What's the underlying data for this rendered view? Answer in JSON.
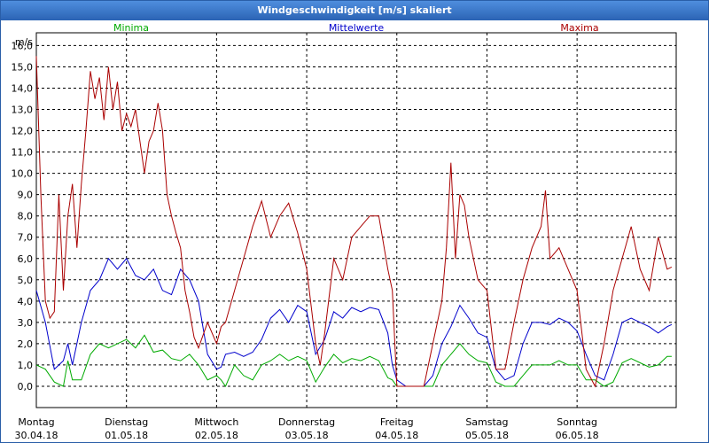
{
  "window": {
    "title": "Windgeschwindigkeit [m/s] skaliert"
  },
  "chart_data": {
    "type": "line",
    "title": "Windgeschwindigkeit [m/s] skaliert",
    "ylabel": "m/s",
    "ylim": [
      -1,
      16.6
    ],
    "y_ticks": [
      "0,0",
      "1,0",
      "2,0",
      "3,0",
      "4,0",
      "5,0",
      "6,0",
      "7,0",
      "8,0",
      "9,0",
      "10,0",
      "11,0",
      "12,0",
      "13,0",
      "14,0",
      "15,0",
      "16,0"
    ],
    "x_range": [
      0,
      7.1
    ],
    "days": [
      {
        "day": "Montag",
        "date": "30.04.18"
      },
      {
        "day": "Dienstag",
        "date": "01.05.18"
      },
      {
        "day": "Mittwoch",
        "date": "02.05.18"
      },
      {
        "day": "Donnerstag",
        "date": "03.05.18"
      },
      {
        "day": "Freitag",
        "date": "04.05.18"
      },
      {
        "day": "Samstag",
        "date": "05.05.18"
      },
      {
        "day": "Sonntag",
        "date": "06.05.18"
      }
    ],
    "grid": true,
    "series": [
      {
        "name": "Minima",
        "color": "#00aa00",
        "x": [
          0.0,
          0.1,
          0.2,
          0.3,
          0.35,
          0.4,
          0.5,
          0.6,
          0.7,
          0.8,
          0.9,
          1.0,
          1.1,
          1.2,
          1.3,
          1.4,
          1.5,
          1.6,
          1.7,
          1.8,
          1.9,
          2.0,
          2.05,
          2.1,
          2.2,
          2.3,
          2.4,
          2.5,
          2.6,
          2.7,
          2.8,
          2.9,
          3.0,
          3.1,
          3.2,
          3.3,
          3.4,
          3.5,
          3.6,
          3.7,
          3.8,
          3.9,
          3.95,
          4.0,
          4.1,
          4.2,
          4.3,
          4.4,
          4.5,
          4.6,
          4.7,
          4.8,
          4.9,
          5.0,
          5.1,
          5.2,
          5.3,
          5.4,
          5.5,
          5.6,
          5.7,
          5.8,
          5.9,
          6.0,
          6.1,
          6.2,
          6.3,
          6.4,
          6.5,
          6.6,
          6.7,
          6.8,
          6.9,
          7.0,
          7.05
        ],
        "y": [
          1.0,
          0.8,
          0.2,
          0.0,
          1.2,
          0.3,
          0.3,
          1.5,
          2.0,
          1.8,
          2.0,
          2.2,
          1.8,
          2.4,
          1.6,
          1.7,
          1.3,
          1.2,
          1.5,
          1.0,
          0.3,
          0.5,
          0.3,
          0.0,
          1.0,
          0.5,
          0.3,
          1.0,
          1.2,
          1.5,
          1.2,
          1.4,
          1.2,
          0.2,
          0.9,
          1.5,
          1.1,
          1.3,
          1.2,
          1.4,
          1.2,
          0.4,
          0.3,
          0.0,
          0.0,
          0.0,
          0.0,
          0.0,
          1.0,
          1.5,
          2.0,
          1.5,
          1.2,
          1.1,
          0.2,
          0.0,
          0.0,
          0.5,
          1.0,
          1.0,
          1.0,
          1.2,
          1.0,
          1.0,
          0.3,
          0.3,
          0.0,
          0.2,
          1.1,
          1.3,
          1.1,
          0.9,
          1.0,
          1.4,
          1.4
        ]
      },
      {
        "name": "Mittelwerte",
        "color": "#0000cc",
        "x": [
          0.0,
          0.1,
          0.2,
          0.3,
          0.35,
          0.4,
          0.5,
          0.6,
          0.7,
          0.8,
          0.9,
          1.0,
          1.1,
          1.2,
          1.3,
          1.4,
          1.5,
          1.6,
          1.7,
          1.8,
          1.9,
          2.0,
          2.05,
          2.1,
          2.2,
          2.3,
          2.4,
          2.5,
          2.6,
          2.7,
          2.8,
          2.9,
          3.0,
          3.1,
          3.2,
          3.3,
          3.4,
          3.5,
          3.6,
          3.7,
          3.8,
          3.9,
          3.95,
          4.0,
          4.1,
          4.2,
          4.3,
          4.4,
          4.5,
          4.6,
          4.7,
          4.8,
          4.9,
          5.0,
          5.1,
          5.2,
          5.3,
          5.4,
          5.5,
          5.6,
          5.7,
          5.8,
          5.9,
          6.0,
          6.1,
          6.2,
          6.3,
          6.4,
          6.5,
          6.6,
          6.7,
          6.8,
          6.9,
          7.0,
          7.05
        ],
        "y": [
          4.5,
          3.0,
          0.8,
          1.2,
          2.0,
          1.0,
          3.0,
          4.5,
          5.0,
          6.0,
          5.5,
          6.0,
          5.2,
          5.0,
          5.5,
          4.5,
          4.3,
          5.5,
          5.0,
          4.0,
          1.5,
          0.8,
          0.9,
          1.5,
          1.6,
          1.4,
          1.6,
          2.2,
          3.2,
          3.6,
          3.0,
          3.8,
          3.5,
          1.5,
          2.2,
          3.5,
          3.2,
          3.7,
          3.5,
          3.7,
          3.6,
          2.5,
          1.0,
          0.3,
          0.0,
          0.0,
          0.0,
          0.5,
          2.0,
          2.8,
          3.8,
          3.2,
          2.5,
          2.3,
          0.8,
          0.3,
          0.5,
          2.0,
          3.0,
          3.0,
          2.9,
          3.2,
          3.0,
          2.6,
          1.5,
          0.5,
          0.3,
          1.5,
          3.0,
          3.2,
          3.0,
          2.8,
          2.5,
          2.8,
          2.9
        ]
      },
      {
        "name": "Maxima",
        "color": "#aa0000",
        "x": [
          0.0,
          0.05,
          0.1,
          0.15,
          0.2,
          0.25,
          0.3,
          0.35,
          0.4,
          0.45,
          0.5,
          0.55,
          0.6,
          0.65,
          0.7,
          0.75,
          0.8,
          0.85,
          0.9,
          0.95,
          1.0,
          1.05,
          1.1,
          1.15,
          1.2,
          1.25,
          1.3,
          1.35,
          1.4,
          1.45,
          1.5,
          1.55,
          1.6,
          1.65,
          1.7,
          1.75,
          1.8,
          1.9,
          2.0,
          2.05,
          2.1,
          2.2,
          2.3,
          2.4,
          2.5,
          2.6,
          2.7,
          2.8,
          2.9,
          3.0,
          3.1,
          3.15,
          3.2,
          3.3,
          3.4,
          3.5,
          3.6,
          3.7,
          3.8,
          3.9,
          3.95,
          4.0,
          4.1,
          4.2,
          4.3,
          4.4,
          4.5,
          4.55,
          4.6,
          4.65,
          4.7,
          4.75,
          4.8,
          4.9,
          5.0,
          5.1,
          5.2,
          5.3,
          5.4,
          5.5,
          5.6,
          5.65,
          5.7,
          5.8,
          5.9,
          6.0,
          6.1,
          6.2,
          6.3,
          6.4,
          6.5,
          6.6,
          6.7,
          6.8,
          6.9,
          7.0,
          7.05
        ],
        "y": [
          15.5,
          9.0,
          4.0,
          3.2,
          3.5,
          9.0,
          4.5,
          8.0,
          9.5,
          6.5,
          9.5,
          12.0,
          14.8,
          13.5,
          14.5,
          12.5,
          15.0,
          13.0,
          14.3,
          12.0,
          12.8,
          12.2,
          13.0,
          11.5,
          10.0,
          11.5,
          12.0,
          13.3,
          12.0,
          9.0,
          8.0,
          7.2,
          6.5,
          4.5,
          3.5,
          2.3,
          1.8,
          3.0,
          2.0,
          2.8,
          3.0,
          4.5,
          6.0,
          7.5,
          8.7,
          7.0,
          8.0,
          8.6,
          7.2,
          5.5,
          2.0,
          1.0,
          2.5,
          6.0,
          5.0,
          7.0,
          7.5,
          8.0,
          8.0,
          5.5,
          4.5,
          0.0,
          0.0,
          0.0,
          0.0,
          2.0,
          4.0,
          6.5,
          10.5,
          6.0,
          9.0,
          8.5,
          7.0,
          5.0,
          4.5,
          0.8,
          0.8,
          3.0,
          5.0,
          6.5,
          7.5,
          9.2,
          6.0,
          6.5,
          5.5,
          4.5,
          0.8,
          0.0,
          2.0,
          4.5,
          6.0,
          7.5,
          5.5,
          4.5,
          7.0,
          5.5,
          5.6
        ]
      }
    ]
  }
}
